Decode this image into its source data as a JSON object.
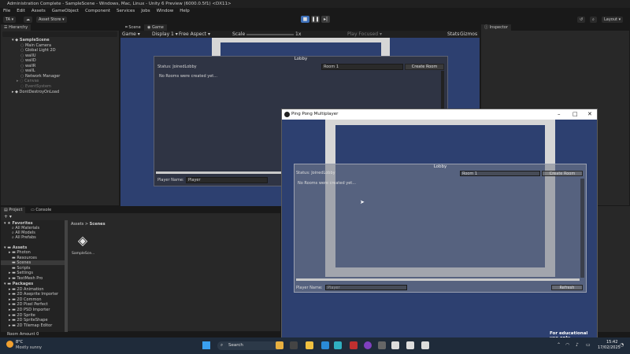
{
  "window_title": "Administration Complete - SampleScene - Windows, Mac, Linux - Unity 6 Preview (6000.0.5f1) <DX11>",
  "menu": [
    "File",
    "Edit",
    "Assets",
    "GameObject",
    "Component",
    "Services",
    "Jobs",
    "Window",
    "Help"
  ],
  "toolbar": {
    "account": "TA",
    "asset_store": "Asset Store",
    "layout": "Layout"
  },
  "hierarchy": {
    "tab": "Hierarchy",
    "rows": [
      "SampleScene",
      "Main Camera",
      "Global Light 2D",
      "wallU",
      "wallD",
      "wallR",
      "wallL",
      "Network Manager",
      "Canvas",
      "EventSystem",
      "DontDestroyOnLoad"
    ]
  },
  "scene_tabs": {
    "scene": "Scene",
    "game": "Game"
  },
  "game_bar": {
    "mode": "Game",
    "display": "Display 1",
    "aspect": "Free Aspect",
    "scale_label": "Scale",
    "scale_value": "1x",
    "play_focused": "Play Focused",
    "stats": "Stats",
    "gizmos": "Gizmos"
  },
  "inspector": {
    "tab": "Inspector"
  },
  "editor_lobby": {
    "title": "Lobby",
    "status": "Status: JoinedLobby",
    "room_input": "Room 1",
    "create_button": "Create Room",
    "empty_message": "No Rooms were created yet...",
    "player_label": "Player Name:",
    "player_value": "Player"
  },
  "project": {
    "tabs": [
      "Project",
      "Console"
    ],
    "favorites_label": "Favorites",
    "favorites": [
      "All Materials",
      "All Models",
      "All Prefabs"
    ],
    "assets_label": "Assets",
    "assets": [
      "Photon",
      "Resources",
      "Scenes",
      "Scripts",
      "Settings",
      "TextMesh Pro"
    ],
    "packages_label": "Packages",
    "packages": [
      "2D Animation",
      "2D Aseprite Importer",
      "2D Common",
      "2D Pixel Perfect",
      "2D PSD Importer",
      "2D Sprite",
      "2D SpriteShape",
      "2D Tilemap Editor"
    ],
    "breadcrumb_root": "Assets",
    "breadcrumb_leaf": "Scenes",
    "file_name": "SampleSce..."
  },
  "status_bar": "Room Amount 0",
  "pp_window": {
    "title": "Ping Pong Multiplayer",
    "lobby_title": "Lobby",
    "status": "Status: JoinedLobby",
    "room_input": "Room 1",
    "create_button": "Create Room",
    "empty_message": "No Rooms were created yet...",
    "player_label": "Player Name:",
    "player_placeholder": "Player",
    "refresh_button": "Refresh"
  },
  "watermark": "For educational use only",
  "taskbar": {
    "temp": "8°C",
    "weather": "Mostly sunny",
    "search": "Search",
    "time": "15:42",
    "date": "17/02/2025"
  },
  "colors": {
    "game_bg": "#2d4070",
    "editor_bg": "#191919",
    "panel": "#282828",
    "taskbar": "#1f2b3a",
    "accent": "#ffffff"
  }
}
